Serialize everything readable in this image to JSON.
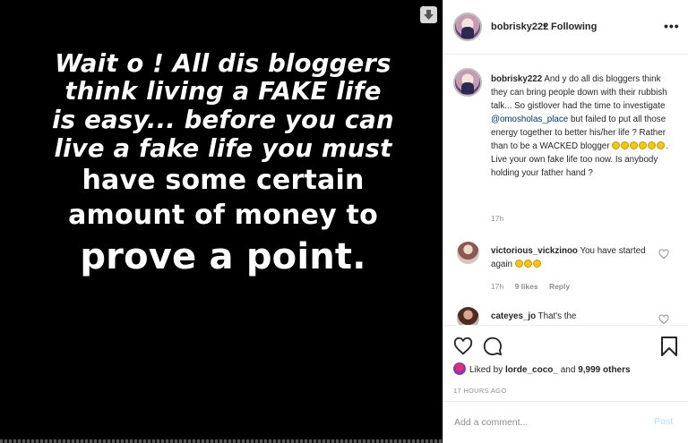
{
  "post": {
    "lines": [
      "Wait o ! All dis bloggers",
      "think living a FAKE life",
      "is easy... before you can",
      "live a fake life you must",
      "have some certain",
      "amount of money to",
      "prove a point."
    ]
  },
  "header": {
    "username": "bobrisky222",
    "separator": "•",
    "follow_status": "Following",
    "more": "•••"
  },
  "caption": {
    "username": "bobrisky222",
    "text_before_mention": "And y do all dis bloggers think they can bring people down with their rubbish talk... So gistlover had the time to investigate",
    "mention": "@omosholas_place",
    "text_after_mention": "but failed to put all those energy together to better his/her life ? Rather than to be a WACKED blogger",
    "text_end": ". Live your own fake life too now. Is anybody holding your father hand ?",
    "time": "17h"
  },
  "comments": [
    {
      "username": "victorious_vickzinoo",
      "text": "You have started again",
      "time": "17h",
      "likes": "9 likes",
      "reply": "Reply"
    },
    {
      "username": "cateyes_jo",
      "text": "That's the",
      "time": "",
      "likes": "",
      "reply": ""
    }
  ],
  "actions": {
    "liked_by_prefix": "Liked by",
    "liked_by_user": "lorde_coco_",
    "liked_by_and": "and",
    "liked_by_others": "9,999 others",
    "post_time": "17 HOURS AGO"
  },
  "add_comment": {
    "placeholder": "Add a comment...",
    "post_label": "Post"
  },
  "colors": {
    "image_bg": "#000000",
    "panel_bg": "#ffffff",
    "text": "#262626",
    "secondary": "#8e8e8e",
    "link": "#00376b",
    "post_disabled": "#b2dffc"
  }
}
